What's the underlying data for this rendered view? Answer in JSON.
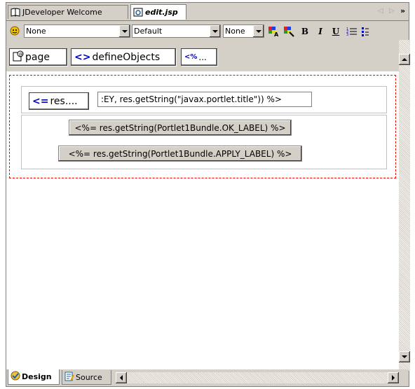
{
  "tabs": [
    {
      "label": "JDeveloper Welcome",
      "icon": "book-icon",
      "active": false
    },
    {
      "label": "edit.jsp",
      "icon": "jsp-file-icon",
      "active": true
    }
  ],
  "toolbar": {
    "style_value": "None",
    "font_value": "Default",
    "size_value": "None",
    "icons": [
      "style-icon",
      "font-color-icon",
      "highlight-icon",
      "bold-icon",
      "italic-icon",
      "underline-icon",
      "numbered-list-icon",
      "bullet-list-icon"
    ],
    "bold_label": "B",
    "italic_label": "I",
    "underline_label": "U"
  },
  "tagbar": {
    "page_label": "page",
    "define_objects_label": "defineObjects",
    "scriptlet_label": "<%..."
  },
  "design": {
    "res_label": "res....",
    "res_symbol": "<=",
    "expression_text": ":EY, res.getString(\"javax.portlet.title\")) %>",
    "ok_button_label": "<%= res.getString(Portlet1Bundle.OK_LABEL) %>",
    "apply_button_label": "<%= res.getString(Portlet1Bundle.APPLY_LABEL) %>"
  },
  "bottom_tabs": [
    {
      "label": "Design",
      "icon": "design-icon",
      "active": true
    },
    {
      "label": "Source",
      "icon": "source-icon",
      "active": false
    }
  ],
  "colors": {
    "selection_border": "#ff0000",
    "tag_accent": "#0000c0",
    "chrome": "#d4d0c8"
  }
}
